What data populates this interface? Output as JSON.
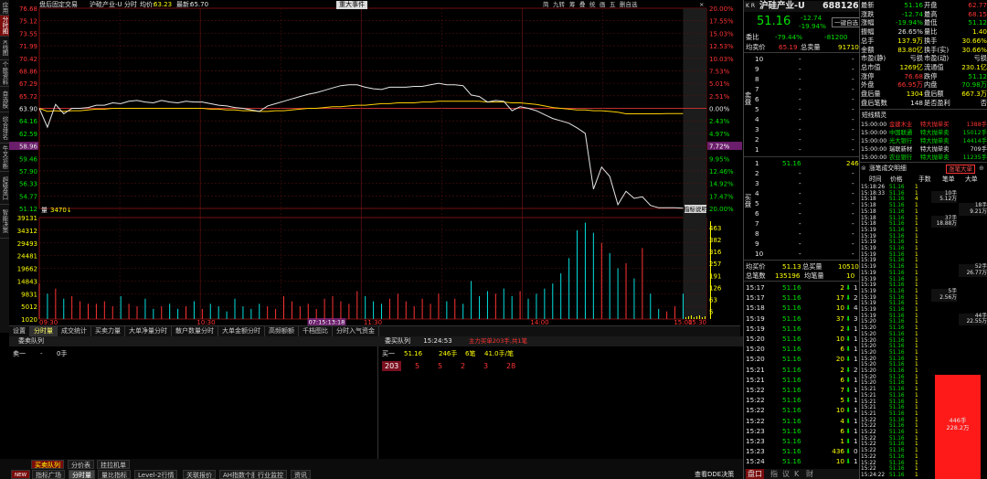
{
  "header": {
    "after_hours": "盘后固定交易",
    "name_code": "沪硅产业-U 分时",
    "avg_label": "均价:",
    "avg_val": "63.23",
    "last_label": "最新:",
    "last_val": "65.70",
    "event_btn": "重大事件",
    "tools": [
      "简",
      "九转",
      "筹",
      "叠",
      "统",
      "画",
      "五",
      "删自选"
    ]
  },
  "sidebar": [
    "应用",
    "分时图",
    "K线图",
    "个股资料",
    "自选股",
    "综合排名",
    "牛叉诊断",
    "超级盘口",
    "智能决策"
  ],
  "chart_data": {
    "type": "line",
    "price_ticks": [
      "76.68",
      "75.12",
      "73.55",
      "71.99",
      "70.42",
      "68.86",
      "67.29",
      "65.72",
      "64.16",
      "62.59",
      "61.03",
      "59.46",
      "57.90",
      "56.33",
      "54.77",
      "53.20"
    ],
    "price_ticks_dark": [
      "63.90",
      "58.96",
      "51.12"
    ],
    "pct_ticks": [
      "20.00%",
      "17.55%",
      "15.03%",
      "12.53%",
      "10.03%",
      "7.53%",
      "5.01%",
      "2.51%",
      "0.00%",
      "2.43%",
      "4.97%",
      "7.72%",
      "9.95%",
      "12.46%",
      "14.92%",
      "17.47%",
      "20.00%"
    ],
    "pct_mark": "7.72%",
    "vol_label": "量",
    "vol_val": "3470↓",
    "vol_ticks": [
      "39131",
      "34312",
      "29493",
      "24481",
      "19662",
      "14843",
      "9831",
      "5012",
      "1020"
    ],
    "vol_right_ticks": [
      "463",
      "382",
      "316",
      "257",
      "191",
      "126",
      "63",
      "5"
    ],
    "time_ticks": [
      "09:30",
      "10:30",
      "11:30",
      "14:00",
      "15:00",
      "15:30"
    ],
    "crosshair": "07:15:13:18",
    "indicator_btn": "指标说明",
    "prev_close": 63.9,
    "upper": 76.68,
    "lower": 51.12,
    "price": [
      63.9,
      61.5,
      64.4,
      63.2,
      63.9,
      63.9,
      64.0,
      64.3,
      64.3,
      64.6,
      64.5,
      64.8,
      64.9,
      64.7,
      64.6,
      64.9,
      64.7,
      64.6,
      64.8,
      64.7,
      64.7,
      64.5,
      64.3,
      64.2,
      64.0,
      63.9,
      63.7,
      63.5,
      64.2,
      64.5,
      64.8,
      65.1,
      65.4,
      65.7,
      65.9,
      66.2,
      66.5,
      66.8,
      66.9,
      66.9,
      66.6,
      66.4,
      66.3,
      66.6,
      66.6,
      66.6,
      66.7,
      66.7,
      66.9,
      67.1,
      66.9,
      66.9,
      66.8,
      65.6,
      65.4,
      64.7,
      64.9,
      64.8,
      63.6,
      64.1,
      63.9,
      63.6,
      63.1,
      62.6,
      62.3,
      62.0,
      61.4,
      60.7,
      53.6,
      56.4,
      55.2,
      51.6,
      53.3,
      52.4,
      52.6,
      51.5,
      51.2,
      51.2,
      51.2,
      51.16
    ],
    "avg": [
      63.9,
      63.5,
      63.6,
      63.5,
      63.6,
      63.6,
      63.7,
      63.8,
      63.8,
      63.9,
      63.9,
      63.9,
      63.9,
      63.9,
      63.9,
      63.9,
      63.9,
      63.9,
      63.9,
      63.9,
      63.9,
      63.8,
      63.8,
      63.7,
      63.7,
      63.6,
      63.6,
      63.5,
      63.5,
      63.6,
      63.6,
      63.7,
      63.8,
      63.9,
      63.9,
      64.0,
      64.1,
      64.1,
      64.2,
      64.3,
      64.3,
      64.4,
      64.5,
      64.5,
      64.6,
      64.6,
      64.6,
      64.7,
      64.7,
      64.8,
      64.8,
      64.8,
      64.8,
      64.8,
      64.8,
      64.7,
      64.7,
      64.7,
      64.6,
      64.6,
      64.5,
      64.4,
      64.2,
      64.0,
      63.9,
      63.8,
      63.7,
      63.7,
      63.6,
      63.6,
      63.5,
      63.4,
      63.2,
      63.2,
      63.2,
      63.2,
      63.2,
      63.23,
      63.23,
      63.23
    ],
    "volume": [
      14,
      10,
      12,
      8,
      9,
      7,
      6,
      6,
      7,
      5,
      9,
      6,
      5,
      8,
      4,
      5,
      6,
      4,
      5,
      7,
      4,
      6,
      5,
      3,
      8,
      5,
      4,
      6,
      5,
      4,
      9,
      7,
      5,
      6,
      4,
      8,
      9,
      7,
      6,
      11,
      9,
      7,
      6,
      8,
      10,
      7,
      5,
      8,
      6,
      10,
      7,
      8,
      6,
      15,
      9,
      11,
      10,
      12,
      9,
      11,
      8,
      10,
      12,
      14,
      18,
      24,
      35,
      38,
      34,
      30,
      26,
      20,
      22,
      16,
      28,
      10,
      4,
      3,
      5,
      10
    ]
  },
  "right_top": {
    "badge": "K R",
    "name": "沪硅产业-U",
    "code": "688126",
    "price": "51.16",
    "chg": "-12.74",
    "pct": "-19.94%",
    "one_btn": "一键自选",
    "wb_label": "委比",
    "wb_pct": "-79.44%",
    "wb_val": "-81200",
    "avg_label": "均卖价",
    "avg_val": "65.19",
    "total_label": "总卖量",
    "total_val": "91710",
    "sell_levels": [
      "10",
      "9",
      "8",
      "7",
      "6",
      "5",
      "4",
      "3",
      "2",
      "1"
    ],
    "sell_dash": "-",
    "buy_levels": [
      "1",
      "2",
      "3",
      "4",
      "5",
      "6",
      "7",
      "8",
      "9",
      "10"
    ],
    "buy1_price": "51.16",
    "buy1_vol": "246",
    "side_sell": "卖盘",
    "side_buy": "买盘",
    "bot_avg_label": "均买价",
    "bot_avg_val": "51.13",
    "bot_total_label": "总买量",
    "bot_total_val": "10510",
    "bot_cnt_label": "总笔数",
    "bot_cnt_val": "135196",
    "bot_per_label": "均笔量",
    "bot_per_val": "10"
  },
  "quote": [
    [
      "最新",
      "51.16",
      "开盘",
      "62.77"
    ],
    [
      "涨跌",
      "-12.74",
      "最高",
      "68.15"
    ],
    [
      "涨幅",
      "-19.94%",
      "最低",
      "51.12"
    ],
    [
      "振幅",
      "26.65%",
      "量比",
      "1.40"
    ],
    [
      "总手",
      "137.9万",
      "换手",
      "30.66%"
    ],
    [
      "金额",
      "83.80亿",
      "换手(实)",
      "30.66%"
    ],
    [
      "市盈(静)",
      "亏损",
      "市盈(动)",
      "亏损"
    ],
    [
      "总市值",
      "1269亿",
      "流通值",
      "230.1亿"
    ],
    [
      "涨停",
      "76.68",
      "跌停",
      "51.12"
    ],
    [
      "外盘",
      "66.95万",
      "内盘",
      "70.98万"
    ],
    [
      "盘后量",
      "1304",
      "盘后额",
      "667.3万"
    ],
    [
      "盘后笔数",
      "148",
      "是否盈利",
      "否"
    ]
  ],
  "sector_title": "短线精灵",
  "sector_rows": [
    [
      "15:00:00",
      "金建木业",
      "特大抛单买",
      "1388手"
    ],
    [
      "15:00:00",
      "中国联通",
      "特大抛单卖",
      "15012手"
    ],
    [
      "15:00:00",
      "光大银行",
      "特大抛单卖",
      "14414手"
    ],
    [
      "15:00:00",
      "瑞联新材",
      "特大抛单卖",
      "709手"
    ],
    [
      "15:00:00",
      "农业银行",
      "特大抛单卖",
      "11235手"
    ]
  ],
  "tick_title": "涨笔成交明细",
  "tick_btn": "涨笔大单",
  "tick_headers": [
    "时间",
    "价格",
    "手数",
    "笔单",
    "大单"
  ],
  "ticks": [
    [
      "15:18:26",
      "51.16",
      "1",
      "",
      ""
    ],
    [
      "15:18:33",
      "51.16",
      "1",
      "10手",
      ""
    ],
    [
      "15:18",
      "51.16",
      "4",
      "5.12万",
      ""
    ],
    [
      "15:18",
      "51.16",
      "1",
      "",
      "18手"
    ],
    [
      "15:18",
      "51.16",
      "1",
      "",
      "9.21万"
    ],
    [
      "15:18",
      "51.16",
      "1",
      "37手",
      ""
    ],
    [
      "15:18",
      "51.16",
      "1",
      "18.88万",
      ""
    ],
    [
      "15:19",
      "51.16",
      "1",
      "",
      ""
    ],
    [
      "15:19",
      "51.16",
      "1",
      "",
      ""
    ],
    [
      "15:19",
      "51.16",
      "1",
      "",
      ""
    ],
    [
      "15:19",
      "51.16",
      "1",
      "",
      ""
    ],
    [
      "15:19",
      "51.16",
      "1",
      "",
      ""
    ],
    [
      "15:19",
      "51.16",
      "1",
      "",
      ""
    ],
    [
      "15:19",
      "51.16",
      "1",
      "",
      "52手"
    ],
    [
      "15:19",
      "51.16",
      "1",
      "",
      "26.77万"
    ],
    [
      "15:19",
      "51.16",
      "1",
      "",
      ""
    ],
    [
      "15:19",
      "51.16",
      "1",
      "",
      ""
    ],
    [
      "15:19",
      "51.16",
      "1",
      "5手",
      ""
    ],
    [
      "15:19",
      "51.16",
      "1",
      "2.56万",
      ""
    ],
    [
      "15:19",
      "51.16",
      "1",
      "",
      ""
    ],
    [
      "15:19",
      "51.16",
      "1",
      "",
      ""
    ],
    [
      "15:19",
      "51.16",
      "1",
      "",
      "44手"
    ],
    [
      "15:20",
      "51.16",
      "1",
      "",
      "22.55万"
    ],
    [
      "15:20",
      "51.16",
      "1",
      "",
      ""
    ],
    [
      "15:20",
      "51.16",
      "1",
      "",
      ""
    ],
    [
      "15:20",
      "51.16",
      "1",
      "",
      ""
    ],
    [
      "15:20",
      "51.16",
      "1",
      "",
      ""
    ],
    [
      "15:20",
      "51.16",
      "1",
      "",
      ""
    ],
    [
      "15:20",
      "51.16",
      "1",
      "",
      ""
    ],
    [
      "15:20",
      "51.16",
      "1",
      "",
      ""
    ],
    [
      "15:20",
      "51.16",
      "1",
      "",
      ""
    ],
    [
      "15:20",
      "51.16",
      "1",
      "",
      ""
    ],
    [
      "15:20",
      "51.16",
      "1",
      "",
      ""
    ],
    [
      "15:21",
      "51.16",
      "1",
      "",
      ""
    ],
    [
      "15:21",
      "51.16",
      "1",
      "",
      ""
    ],
    [
      "15:21",
      "51.16",
      "1",
      "",
      ""
    ],
    [
      "15:21",
      "51.16",
      "1",
      "",
      ""
    ],
    [
      "15:21",
      "51.16",
      "1",
      "",
      ""
    ],
    [
      "15:22",
      "51.16",
      "1",
      "",
      ""
    ],
    [
      "15:22",
      "51.16",
      "1",
      "",
      ""
    ],
    [
      "15:22",
      "51.16",
      "1",
      "",
      ""
    ],
    [
      "15:22",
      "51.16",
      "1",
      "",
      ""
    ],
    [
      "15:22",
      "51.16",
      "1",
      "",
      ""
    ],
    [
      "15:22",
      "51.16",
      "1",
      "",
      ""
    ],
    [
      "15:22",
      "51.16",
      "1",
      "",
      ""
    ],
    [
      "15:22",
      "51.16",
      "1",
      "",
      ""
    ],
    [
      "15:22",
      "51.16",
      "1",
      "",
      ""
    ],
    [
      "15:24:22",
      "51.16",
      "1",
      "",
      ""
    ]
  ],
  "red_bar": {
    "vol": "446手",
    "amt": "228.2万",
    "value": 446
  },
  "trades": [
    [
      "15:17",
      "51.16",
      "2",
      "1"
    ],
    [
      "15:17",
      "51.16",
      "17",
      "2"
    ],
    [
      "15:18",
      "51.16",
      "10",
      "4"
    ],
    [
      "15:19",
      "51.16",
      "37",
      "3"
    ],
    [
      "15:19",
      "51.16",
      "2",
      "1"
    ],
    [
      "15:20",
      "51.16",
      "10",
      "1"
    ],
    [
      "15:20",
      "51.16",
      "6",
      "1"
    ],
    [
      "15:20",
      "51.16",
      "20",
      "1"
    ],
    [
      "15:21",
      "51.16",
      "2",
      "2"
    ],
    [
      "15:21",
      "51.16",
      "6",
      "1"
    ],
    [
      "15:22",
      "51.16",
      "7",
      "1"
    ],
    [
      "15:22",
      "51.16",
      "5",
      "1"
    ],
    [
      "15:22",
      "51.16",
      "10",
      "1"
    ],
    [
      "15:22",
      "51.16",
      "4",
      "1"
    ],
    [
      "15:23",
      "51.16",
      "6",
      "1"
    ],
    [
      "15:23",
      "51.16",
      "1",
      "1"
    ],
    [
      "15:23",
      "51.16",
      "436",
      "0"
    ],
    [
      "15:24",
      "51.16",
      "10",
      "1"
    ]
  ],
  "rp_bottom": [
    "盘口",
    "指",
    "议",
    "K",
    "财"
  ],
  "chart_tabs": [
    "设置",
    "分时量",
    "成交统计",
    "买卖力量",
    "大单净量分时",
    "散户数量分时",
    "大单金额分时",
    "高频额额",
    "千档图比",
    "分时入气资金"
  ],
  "queue": {
    "title": "委卖队列",
    "title2": "委买队列",
    "time": "15:24:53",
    "note": "主力买单203手,共1笔",
    "sell1": "卖一",
    "sell1_dash": "-",
    "sell1_vol": "0手",
    "buy1": "买一",
    "buy1_price": "51.16",
    "buy1_vol": "246手",
    "buy1_cnt": "6笔",
    "buy1_per": "41.0手/笔",
    "queue_vals": [
      "203",
      "5",
      "5",
      "2",
      "3",
      "28"
    ]
  },
  "bottom_tabs": [
    "买卖队列",
    "分价表",
    "挂拉机单"
  ],
  "bottom_tabs2": [
    "NEW",
    "指标广场",
    "分时量",
    "量比指标",
    "Level-2行情",
    "关联报价",
    "AH指数个股",
    "行业监控",
    "资讯"
  ],
  "bottom_right": "查看DDE决策"
}
